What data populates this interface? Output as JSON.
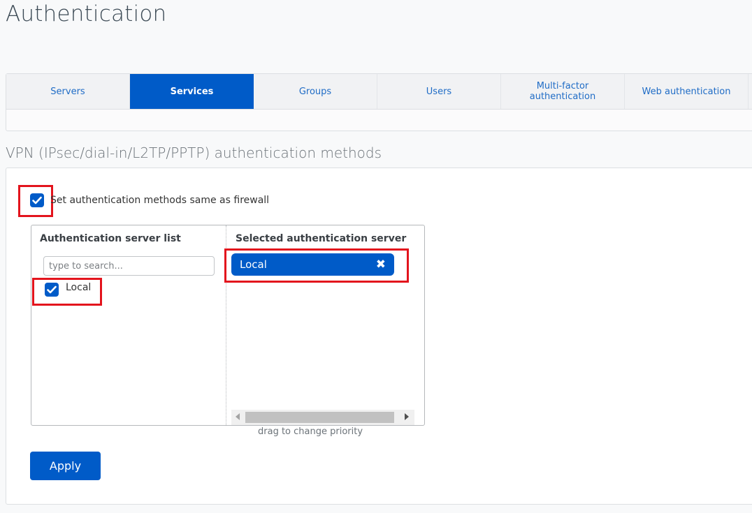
{
  "page": {
    "title": "Authentication"
  },
  "tabs": [
    {
      "label": "Servers",
      "active": false
    },
    {
      "label": "Services",
      "active": true
    },
    {
      "label": "Groups",
      "active": false
    },
    {
      "label": "Users",
      "active": false
    },
    {
      "label": "Multi-factor authentication",
      "active": false
    },
    {
      "label": "Web authentication",
      "active": false
    }
  ],
  "section": {
    "title": "VPN (IPsec/dial-in/L2TP/PPTP) authentication methods",
    "same_as_firewall": {
      "label": "Set authentication methods same as firewall",
      "checked": true
    },
    "server_list": {
      "heading": "Authentication server list",
      "search_placeholder": "type to search...",
      "items": [
        {
          "label": "Local",
          "checked": true
        }
      ]
    },
    "selected": {
      "heading": "Selected authentication server",
      "items": [
        {
          "label": "Local",
          "remove_icon": "close-icon"
        }
      ]
    },
    "hint": "drag to change priority",
    "apply_label": "Apply"
  },
  "colors": {
    "accent": "#005bc8",
    "highlight": "#e3141d"
  }
}
